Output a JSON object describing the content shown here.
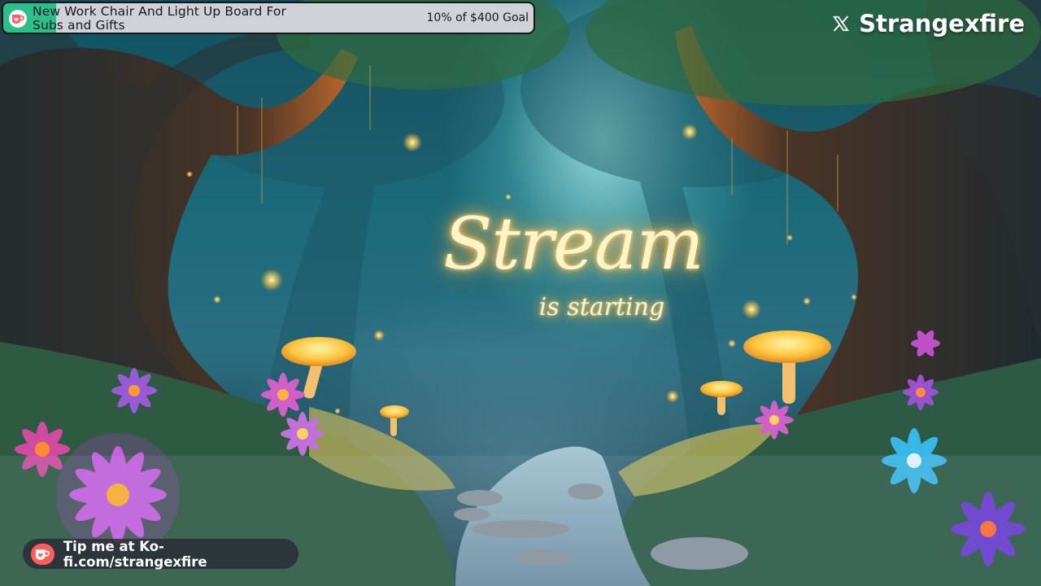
{
  "goal": {
    "title": "New Work Chair And Light Up Board For Subs and Gifts",
    "progress_text": "10% of $400 Goal",
    "progress_fraction": 0.1,
    "icon": "kofi-cup-icon",
    "fill_color": "#29c08c"
  },
  "social": {
    "icon": "x-logo-icon",
    "handle": "Strangexfire"
  },
  "scene": {
    "title": "Stream",
    "subtitle": "is starting",
    "glow_color": "#ffd77a"
  },
  "tip": {
    "icon": "kofi-cup-icon",
    "text": "Tip me at Ko-fi.com/strangexfire",
    "accent_color": "#ff5e5b"
  }
}
